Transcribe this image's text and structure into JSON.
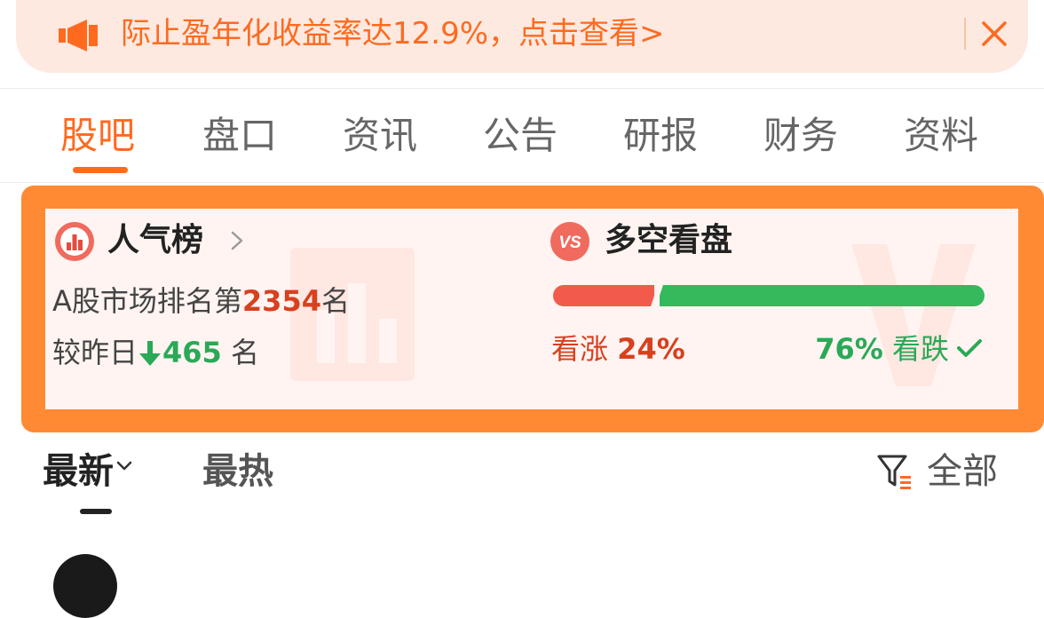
{
  "banner": {
    "text": "际止盈年化收益率达12.9%，点击查看>",
    "icon": "megaphone-icon",
    "close_icon": "close-icon"
  },
  "tabs": [
    {
      "label": "股吧",
      "active": true
    },
    {
      "label": "盘口",
      "active": false
    },
    {
      "label": "资讯",
      "active": false
    },
    {
      "label": "公告",
      "active": false
    },
    {
      "label": "研报",
      "active": false
    },
    {
      "label": "财务",
      "active": false
    },
    {
      "label": "资料",
      "active": false
    }
  ],
  "popularity": {
    "title": "人气榜",
    "rank_prefix": "A股市场排名第",
    "rank": "2354",
    "rank_suffix": "名",
    "change_prefix": "较昨日",
    "change": "465",
    "change_suffix": " 名",
    "change_direction": "down"
  },
  "sentiment": {
    "title": "多空看盘",
    "bull_label": "看涨",
    "bull_pct": "24%",
    "bear_label": "看跌",
    "bear_pct": "76%",
    "bull_fraction": 0.24,
    "bear_fraction": 0.76
  },
  "sort": {
    "latest_label": "最新",
    "hot_label": "最热",
    "filter_label": "全部"
  },
  "colors": {
    "accent": "#ff6a1f",
    "frame": "#ff8a33",
    "up": "#f25a4b",
    "down": "#34b95d",
    "rank": "#d8401e"
  }
}
